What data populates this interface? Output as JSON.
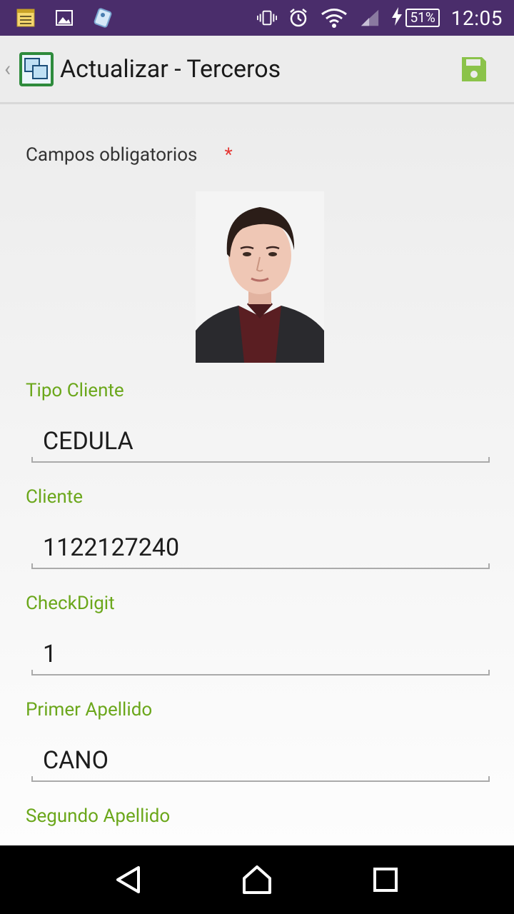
{
  "status_bar": {
    "time": "12:05",
    "battery": "51%",
    "icons": [
      "notes-icon",
      "image-icon",
      "tag-icon",
      "vibrate-icon",
      "alarm-icon",
      "wifi-icon",
      "signal-icon",
      "charging-icon"
    ]
  },
  "action_bar": {
    "title": "Actualizar - Terceros",
    "logo_icon": "app-window-logo",
    "save_icon": "save-icon"
  },
  "form": {
    "required_label": "Campos obligatorios",
    "required_mark": "*",
    "fields": [
      {
        "label": "Tipo Cliente",
        "value": "CEDULA"
      },
      {
        "label": "Cliente",
        "value": "1122127240"
      },
      {
        "label": "CheckDigit",
        "value": "1"
      },
      {
        "label": "Primer Apellido",
        "value": "CANO"
      },
      {
        "label": "Segundo Apellido",
        "value": ""
      }
    ]
  },
  "colors": {
    "status_bar": "#4a2d6b",
    "accent_green": "#6ba71b",
    "save_green": "#8bc34a"
  }
}
